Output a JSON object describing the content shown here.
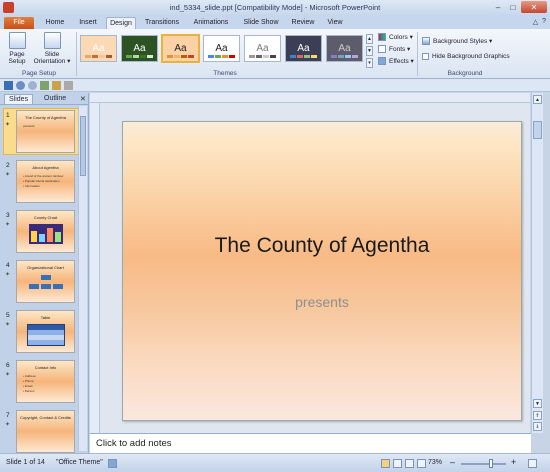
{
  "window": {
    "title": "ind_5334_slide.ppt [Compatibility Mode] - Microsoft PowerPoint",
    "min": "–",
    "max": "□",
    "close": "✕"
  },
  "ribbon_tabs": [
    {
      "label": "File"
    },
    {
      "label": "Home"
    },
    {
      "label": "Insert"
    },
    {
      "label": "Design"
    },
    {
      "label": "Transitions"
    },
    {
      "label": "Animations"
    },
    {
      "label": "Slide Show"
    },
    {
      "label": "Review"
    },
    {
      "label": "View"
    }
  ],
  "ribbon": {
    "page_setup": {
      "label": "Page\nSetup",
      "label1": "Page",
      "label2": "Setup"
    },
    "slide_orientation": {
      "label1": "Slide",
      "label2": "Orientation ▾"
    },
    "group_page_setup": "Page Setup",
    "group_themes": "Themes",
    "group_background": "Background",
    "themes": [
      {
        "label": "Aa",
        "bg": "#fcd9b5",
        "fg": "#ffffff"
      },
      {
        "label": "Aa",
        "bg": "#2d5224",
        "fg": "#ffffff"
      },
      {
        "label": "Aa",
        "bg": "#fbd2a6",
        "fg": "#222222"
      },
      {
        "label": "Aa",
        "bg": "#ffffff",
        "fg": "#222222"
      },
      {
        "label": "Aa",
        "bg": "#ffffff",
        "fg": "#777777"
      },
      {
        "label": "Aa",
        "bg": "#3a3f55",
        "fg": "#ffffff"
      },
      {
        "label": "Aa",
        "bg": "#5c5c6c",
        "fg": "#cccccc"
      }
    ],
    "colors": "Colors ▾",
    "fonts": "Fonts ▾",
    "effects": "Effects ▾",
    "background_styles": "Background Styles ▾",
    "hide_background_graphics": "Hide Background Graphics"
  },
  "panel": {
    "tabs": [
      "Slides",
      "Outline"
    ],
    "close": "✕",
    "slides": [
      {
        "num": "1",
        "title": "The County of Agentha",
        "lines": [
          "presents"
        ]
      },
      {
        "num": "2",
        "title": "About Agentha",
        "lines": [
          "• A land of the ancient rainbow",
          "• Popular tourist destination",
          "• Information"
        ]
      },
      {
        "num": "3",
        "title": "County Chart",
        "lines": []
      },
      {
        "num": "4",
        "title": "Organizational Chart",
        "lines": []
      },
      {
        "num": "5",
        "title": "Table",
        "lines": []
      },
      {
        "num": "6",
        "title": "Contact Info",
        "lines": [
          "• Address",
          "• Phone",
          "• Email",
          "• Person"
        ]
      },
      {
        "num": "7",
        "title": "Copyright, Contact & Credits",
        "lines": []
      }
    ]
  },
  "slide": {
    "title": "The County of Agentha",
    "subtitle": "presents"
  },
  "notes": {
    "placeholder": "Click to add notes"
  },
  "status": {
    "slide_info": "Slide 1 of 14",
    "theme": "\"Office Theme\"",
    "zoom": "73%",
    "minus": "–",
    "plus": "+"
  }
}
